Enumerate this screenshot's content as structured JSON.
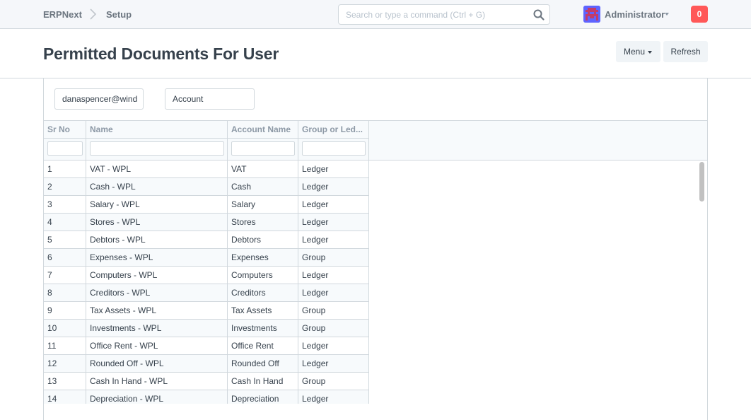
{
  "navbar": {
    "brand": "ERPNext",
    "breadcrumb": "Setup",
    "search_placeholder": "Search or type a command (Ctrl + G)",
    "user_name": "Administrator",
    "notification_count": "0"
  },
  "page": {
    "title": "Permitted Documents For User",
    "menu_label": "Menu",
    "refresh_label": "Refresh"
  },
  "filters": {
    "user": "danaspencer@wind",
    "doctype": "Account"
  },
  "table": {
    "columns": [
      "Sr No",
      "Name",
      "Account Name",
      "Group or Led..."
    ],
    "rows": [
      [
        "1",
        "VAT - WPL",
        "VAT",
        "Ledger"
      ],
      [
        "2",
        "Cash - WPL",
        "Cash",
        "Ledger"
      ],
      [
        "3",
        "Salary - WPL",
        "Salary",
        "Ledger"
      ],
      [
        "4",
        "Stores - WPL",
        "Stores",
        "Ledger"
      ],
      [
        "5",
        "Debtors - WPL",
        "Debtors",
        "Ledger"
      ],
      [
        "6",
        "Expenses - WPL",
        "Expenses",
        "Group"
      ],
      [
        "7",
        "Computers - WPL",
        "Computers",
        "Ledger"
      ],
      [
        "8",
        "Creditors - WPL",
        "Creditors",
        "Ledger"
      ],
      [
        "9",
        "Tax Assets - WPL",
        "Tax Assets",
        "Group"
      ],
      [
        "10",
        "Investments - WPL",
        "Investments",
        "Group"
      ],
      [
        "11",
        "Office Rent - WPL",
        "Office Rent",
        "Ledger"
      ],
      [
        "12",
        "Rounded Off - WPL",
        "Rounded Off",
        "Ledger"
      ],
      [
        "13",
        "Cash In Hand - WPL",
        "Cash In Hand",
        "Group"
      ],
      [
        "14",
        "Depreciation - WPL",
        "Depreciation",
        "Ledger"
      ]
    ]
  },
  "colors": {
    "navbar_bg": "#f5f7fa",
    "notification_badge": "#ff5858",
    "avatar_bg": "#5e64ff",
    "border": "#d1d8dd",
    "header_text": "#8d99a6"
  },
  "icons": {
    "search": "search-icon",
    "breadcrumb_separator": "chevron-right-icon",
    "avatar": "avatar-icon"
  }
}
